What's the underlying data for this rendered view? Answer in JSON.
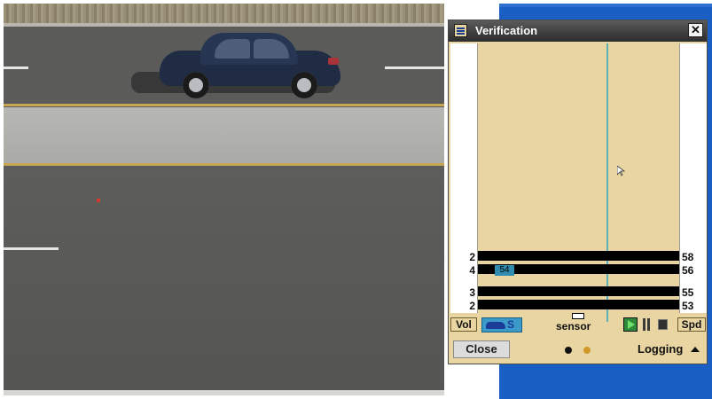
{
  "window": {
    "title": "Verification",
    "close_glyph": "✕"
  },
  "lanes": [
    {
      "volume": "2",
      "speed": "58"
    },
    {
      "volume": "4",
      "speed": "56",
      "tag": "54"
    },
    {
      "volume": "3",
      "speed": "55"
    },
    {
      "volume": "2",
      "speed": "53"
    }
  ],
  "controls": {
    "vol_label": "Vol",
    "spd_label": "Spd",
    "speed_filter_letter": "S",
    "sensor_label": "sensor"
  },
  "footer": {
    "close_label": "Close",
    "logging_label": "Logging"
  },
  "colors": {
    "track": "#e8d5a2",
    "sensor_line": "#5ab0b4",
    "desktop": "#1a5fc4"
  },
  "icons": [
    "app-icon",
    "close-icon",
    "car-icon",
    "sensor-icon",
    "play-icon",
    "pause-icon",
    "stop-icon",
    "caret-up-icon"
  ]
}
